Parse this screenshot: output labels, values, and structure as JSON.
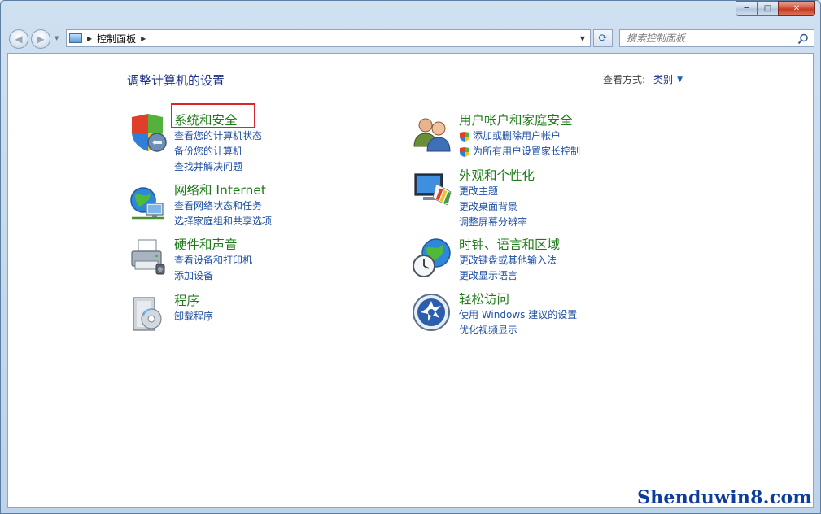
{
  "window": {
    "minimize_label": "─",
    "maximize_label": "□",
    "close_label": "✕"
  },
  "nav": {
    "back_glyph": "◀",
    "forward_glyph": "▶",
    "dropdown_glyph": "▼",
    "breadcrumb": [
      "控制面板"
    ],
    "breadcrumb_arrow": "▶",
    "refresh_glyph": "⟳"
  },
  "search": {
    "placeholder": "搜索控制面板",
    "value": ""
  },
  "content": {
    "heading": "调整计算机的设置",
    "view_by_label": "查看方式:",
    "view_by_value": "类别",
    "view_by_caret": "▼"
  },
  "categories": [
    {
      "id": "system-security",
      "title": "系统和安全",
      "links": [
        "查看您的计算机状态",
        "备份您的计算机",
        "查找并解决问题"
      ]
    },
    {
      "id": "network",
      "title": "网络和 Internet",
      "links": [
        "查看网络状态和任务",
        "选择家庭组和共享选项"
      ]
    },
    {
      "id": "hardware",
      "title": "硬件和声音",
      "links": [
        "查看设备和打印机",
        "添加设备"
      ]
    },
    {
      "id": "programs",
      "title": "程序",
      "links": [
        "卸载程序"
      ]
    },
    {
      "id": "user-accounts",
      "title": "用户帐户和家庭安全",
      "links": [
        "添加或删除用户帐户",
        "为所有用户设置家长控制"
      ]
    },
    {
      "id": "appearance",
      "title": "外观和个性化",
      "links": [
        "更改主题",
        "更改桌面背景",
        "调整屏幕分辨率"
      ]
    },
    {
      "id": "clock-region",
      "title": "时钟、语言和区域",
      "links": [
        "更改键盘或其他输入法",
        "更改显示语言"
      ]
    },
    {
      "id": "ease-of-access",
      "title": "轻松访问",
      "links": [
        "使用 Windows 建议的设置",
        "优化视频显示"
      ]
    }
  ],
  "watermark": "Shenduwin8.com",
  "colors": {
    "category_title": "#1d7a17",
    "link": "#1e4fa3",
    "heading": "#1e3287",
    "highlight_box": "#d8262e"
  },
  "icons": {
    "system-security": "shield-icon",
    "network": "network-globe-icon",
    "hardware": "printer-icon",
    "programs": "program-box-icon",
    "user-accounts": "users-icon",
    "appearance": "monitor-palette-icon",
    "clock-region": "globe-clock-icon",
    "ease-of-access": "ease-access-icon"
  }
}
